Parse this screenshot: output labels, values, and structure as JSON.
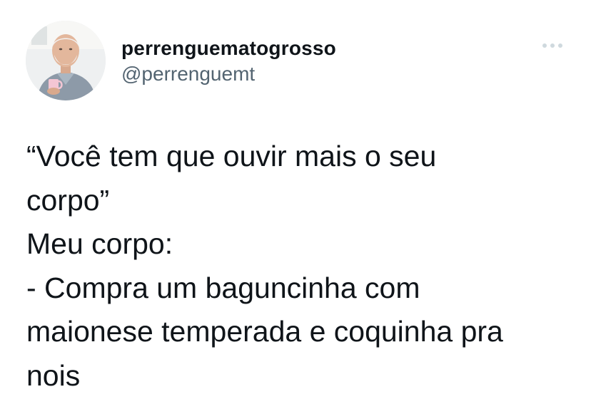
{
  "tweet": {
    "author": {
      "display_name": "perrenguematogrosso",
      "handle": "@perrenguemt",
      "avatar_icon": "user-avatar-photo"
    },
    "more_icon": "more-horizontal-icon",
    "text_lines": [
      "“Você tem que ouvir mais o seu",
      "corpo”",
      "Meu corpo:",
      "- Compra um baguncinha com",
      "maionese temperada e coquinha pra",
      "nois"
    ]
  },
  "colors": {
    "text_primary": "#0f1419",
    "text_secondary": "#536471",
    "background": "#ffffff"
  }
}
